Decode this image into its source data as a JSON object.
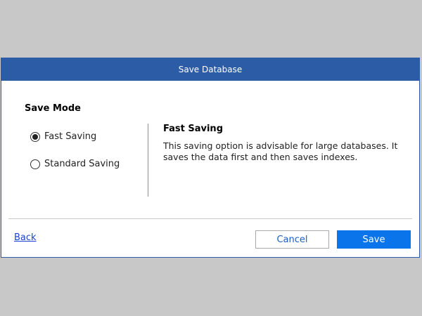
{
  "window": {
    "title": "Save Database"
  },
  "save_mode": {
    "heading": "Save Mode",
    "options": [
      {
        "label": "Fast Saving",
        "selected": true
      },
      {
        "label": "Standard Saving",
        "selected": false
      }
    ]
  },
  "description": {
    "title": "Fast Saving",
    "text": "This saving option is advisable for large databases. It saves the data first and then saves indexes."
  },
  "footer": {
    "back_label": "Back",
    "cancel_label": "Cancel",
    "save_label": "Save"
  },
  "colors": {
    "titlebar": "#2d5ca6",
    "primary_button": "#0a74ea",
    "link": "#1a3fcf"
  }
}
